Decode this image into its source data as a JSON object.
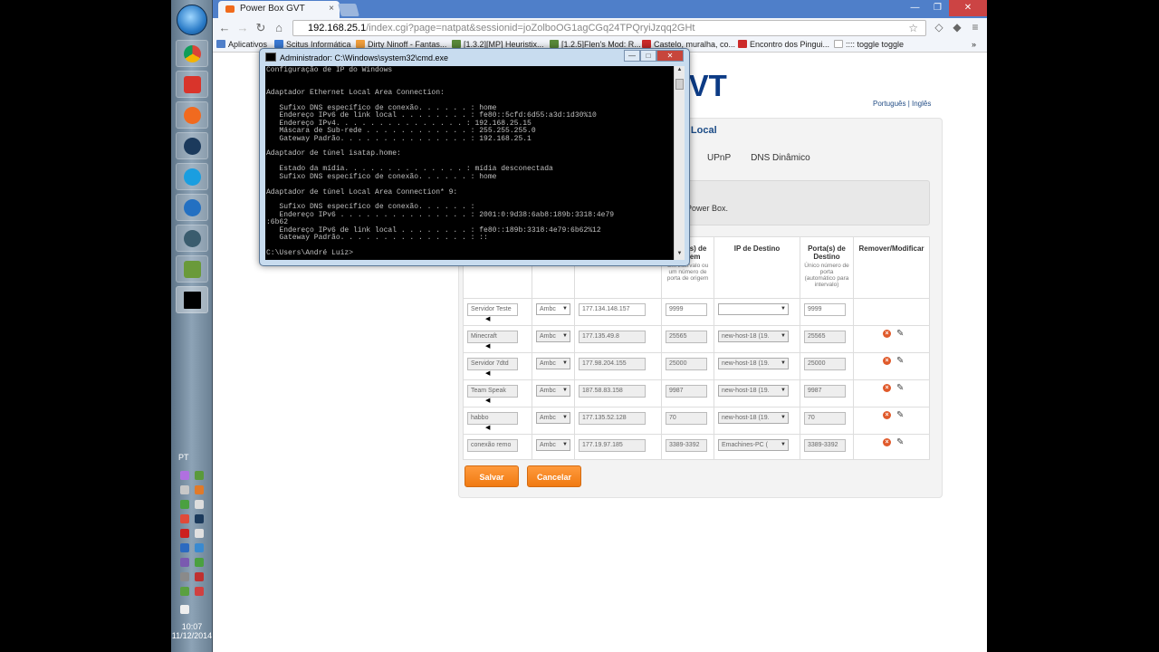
{
  "taskbar": {
    "lang": "PT",
    "clock_time": "10:07",
    "clock_date": "11/12/2014",
    "apps": [
      "chrome-icon",
      "pin-icon",
      "orange-circle-icon",
      "steam-icon",
      "skype-icon",
      "browser-c-icon",
      "media-icon",
      "network-icon",
      "cmd-icon"
    ]
  },
  "browser": {
    "tab_title": "Power Box GVT",
    "tab_close": "×",
    "url_host": "192.168.25.1",
    "url_path": "/index.cgi?page=natpat&sessionid=joZolboOG1agCGq24TPQryiJzqq2GHt",
    "nav_back": "←",
    "nav_forward": "→",
    "nav_reload": "↻",
    "nav_home": "⌂",
    "bookmarks": [
      {
        "label": "Aplicativos",
        "color": "#4f7fc9"
      },
      {
        "label": "Scitus Informática",
        "color": "#3b7bd6"
      },
      {
        "label": "Dirty Ninoff - Fantas...",
        "color": "#f2a03d"
      },
      {
        "label": "[1.3.2][MP] Heuristix...",
        "color": "#5a8a3a"
      },
      {
        "label": "[1.2.5]Flen's Mod: R...",
        "color": "#5a8a3a"
      },
      {
        "label": "Castelo, muralha, co...",
        "color": "#cc2a2a"
      },
      {
        "label": "Encontro dos Pingui...",
        "color": "#cc2a2a"
      },
      {
        "label": ":::: toggle toggle",
        "color": "#cccccc"
      }
    ],
    "more": "»"
  },
  "page": {
    "brand": "GVT",
    "langs": "Português | Inglês",
    "section_title": "de Local",
    "subtabs": [
      "UPnP",
      "DNS Dinâmico"
    ],
    "info_text": "Power Box.",
    "table": {
      "headers": [
        {
          "label": "",
          "note": ""
        },
        {
          "label": "",
          "note": ""
        },
        {
          "label": "",
          "note": ""
        },
        {
          "label": "Porta(s) de Origem",
          "note": "Um intervalo ou um número de porta de origem"
        },
        {
          "label": "IP de Destino",
          "note": ""
        },
        {
          "label": "Porta(s) de Destino",
          "note": "Único número de porta (automático para intervalo)"
        },
        {
          "label": "Remover/Modificar",
          "note": ""
        }
      ],
      "rows": [
        {
          "name": "Servidor Teste",
          "proto": "Ambc",
          "ip": "177.134.148.157",
          "src": "9999",
          "dest": "",
          "dport": "9999",
          "editable": true
        },
        {
          "name": "Minecraft",
          "proto": "Ambc",
          "ip": "177.135.49.8",
          "src": "25565",
          "dest": "new-host-18 (19.",
          "dport": "25565",
          "editable": false
        },
        {
          "name": "Servidor 7dtd",
          "proto": "Ambc",
          "ip": "177.98.204.155",
          "src": "25000",
          "dest": "new-host-18 (19.",
          "dport": "25000",
          "editable": false
        },
        {
          "name": "Team Speak",
          "proto": "Ambc",
          "ip": "187.58.83.158",
          "src": "9987",
          "dest": "new-host-18 (19.",
          "dport": "9987",
          "editable": false
        },
        {
          "name": "habbo",
          "proto": "Ambc",
          "ip": "177.135.52.128",
          "src": "70",
          "dest": "new-host-18 (19.",
          "dport": "70",
          "editable": false
        },
        {
          "name": "conexão remo",
          "proto": "Ambc",
          "ip": "177.19.97.185",
          "src": "3389-3392",
          "dest": "Emachines-PC (",
          "dport": "3389-3392",
          "editable": false
        }
      ]
    },
    "save_label": "Salvar",
    "cancel_label": "Cancelar"
  },
  "cmd": {
    "title": "Administrador: C:\\Windows\\system32\\cmd.exe",
    "output": "Configuração de IP do Windows\n\n\nAdaptador Ethernet Local Area Connection:\n\n   Sufixo DNS específico de conexão. . . . . . : home\n   Endereço IPv6 de link local . . . . . . . . : fe80::5cfd:6d55:a3d:1d30%10\n   Endereço IPv4. . . . . . . . . . . . . . . : 192.168.25.15\n   Máscara de Sub-rede . . . . . . . . . . . . : 255.255.255.0\n   Gateway Padrão. . . . . . . . . . . . . . . : 192.168.25.1\n\nAdaptador de túnel isatap.home:\n\n   Estado da mídia. . . . . . . . . . . . . . : mídia desconectada\n   Sufixo DNS específico de conexão. . . . . . : home\n\nAdaptador de túnel Local Area Connection* 9:\n\n   Sufixo DNS específico de conexão. . . . . . :\n   Endereço IPv6 . . . . . . . . . . . . . . . : 2001:0:9d38:6ab8:189b:3318:4e79\n:6b62\n   Endereço IPv6 de link local . . . . . . . . : fe80::189b:3318:4e79:6b62%12\n   Gateway Padrão. . . . . . . . . . . . . . . : ::\n\nC:\\Users\\André Luiz>"
  }
}
